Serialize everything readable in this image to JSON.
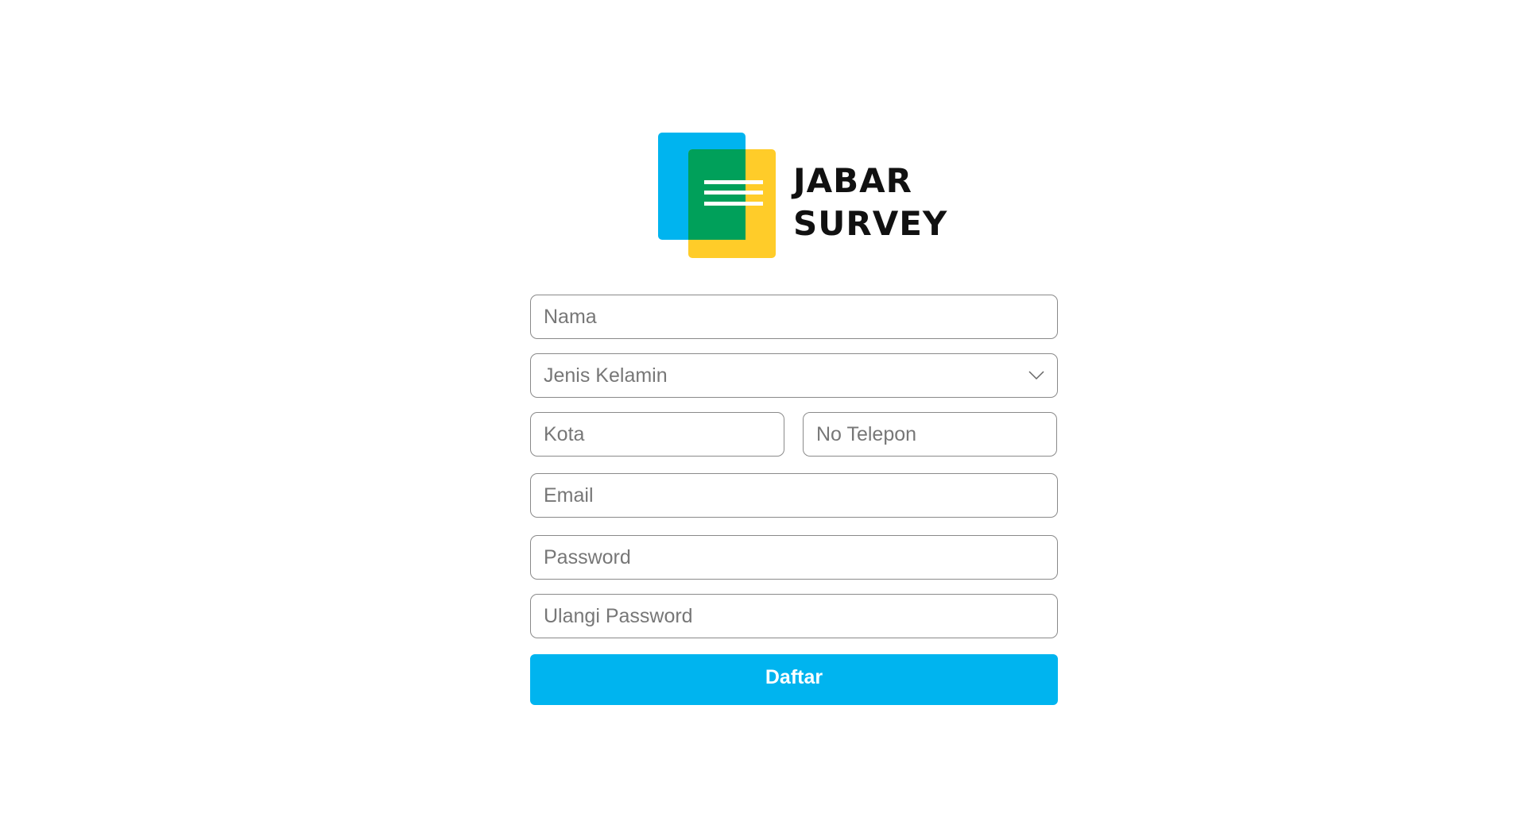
{
  "brand": {
    "line1": "JABAR",
    "line2": "SURVEY",
    "icon": "document-stack-logo",
    "colors": {
      "blue": "#00b4ef",
      "green": "#00a05a",
      "yellow": "#ffcc29"
    }
  },
  "form": {
    "name_placeholder": "Nama",
    "gender_placeholder": "Jenis Kelamin",
    "city_placeholder": "Kota",
    "phone_placeholder": "No Telepon",
    "email_placeholder": "Email",
    "password_placeholder": "Password",
    "repeat_password_placeholder": "Ulangi Password",
    "gender_icon": "chevron-down-icon",
    "submit_label": "Daftar",
    "accent_color": "#00b4ef"
  }
}
